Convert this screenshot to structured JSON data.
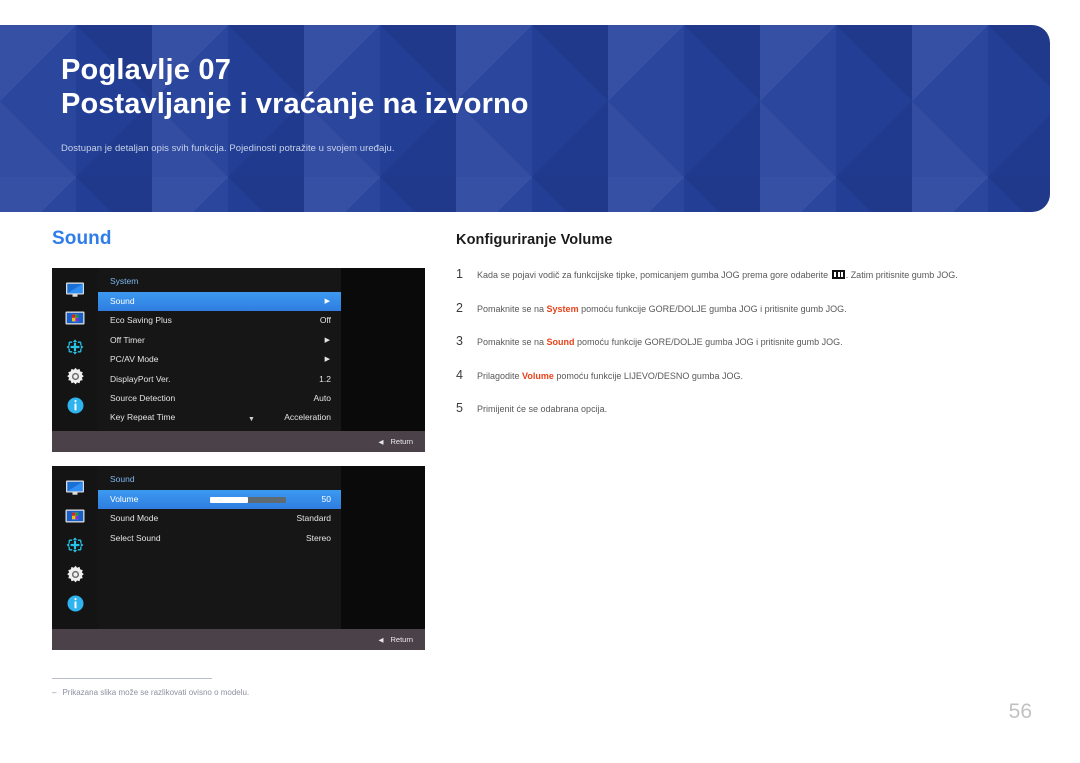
{
  "banner": {
    "chapter_label": "Poglavlje  07",
    "title": "Postavljanje i vraćanje na izvorno",
    "subtitle": "Dostupan je detaljan opis svih funkcija. Pojedinosti potražite u svojem uređaju.",
    "background_color": "#23409a"
  },
  "left": {
    "section_heading": "Sound",
    "accent_color": "#2f7dea"
  },
  "osd1": {
    "title": "System",
    "rail_icons": [
      "monitor-icon",
      "picture-color-icon",
      "directional-pad-icon",
      "gear-icon",
      "info-icon"
    ],
    "rows": [
      {
        "label": "Sound",
        "value": "",
        "arrow": "▶",
        "selected": true
      },
      {
        "label": "Eco Saving Plus",
        "value": "Off",
        "arrow": "",
        "selected": false
      },
      {
        "label": "Off Timer",
        "value": "",
        "arrow": "▶",
        "selected": false
      },
      {
        "label": "PC/AV Mode",
        "value": "",
        "arrow": "▶",
        "selected": false
      },
      {
        "label": "DisplayPort Ver.",
        "value": "1.2",
        "arrow": "",
        "selected": false
      },
      {
        "label": "Source Detection",
        "value": "Auto",
        "arrow": "",
        "selected": false
      },
      {
        "label": "Key Repeat Time",
        "value": "Acceleration",
        "arrow": "",
        "selected": false
      }
    ],
    "scroll_caret": "▼",
    "footer_arrow": "◀",
    "footer_label": "Return"
  },
  "osd2": {
    "title": "Sound",
    "rail_icons": [
      "monitor-icon",
      "picture-color-icon",
      "directional-pad-icon",
      "gear-icon",
      "info-icon"
    ],
    "rows": [
      {
        "label": "Volume",
        "value": "50",
        "slider_percent": 50,
        "selected": true
      },
      {
        "label": "Sound Mode",
        "value": "Standard",
        "selected": false
      },
      {
        "label": "Select Sound",
        "value": "Stereo",
        "selected": false
      }
    ],
    "footer_arrow": "◀",
    "footer_label": "Return"
  },
  "footnote": {
    "dash": "–",
    "text": "Prikazana slika može se razlikovati ovisno o modelu."
  },
  "right": {
    "heading": "Konfiguriranje Volume",
    "steps": [
      {
        "num": "1",
        "pre": "Kada se pojavi vodič za funkcijske tipke, pomicanjem gumba JOG prema gore odaberite ",
        "glyph": "menu-icon",
        "post": ". Zatim pritisnite gumb JOG.",
        "bold": ""
      },
      {
        "num": "2",
        "pre": "Pomaknite se na ",
        "bold": "System",
        "post": " pomoću funkcije GORE/DOLJE gumba JOG i pritisnite gumb JOG."
      },
      {
        "num": "3",
        "pre": "Pomaknite se na ",
        "bold": "Sound",
        "post": " pomoću funkcije GORE/DOLJE gumba JOG i pritisnite gumb JOG."
      },
      {
        "num": "4",
        "pre": "Prilagodite ",
        "bold": "Volume",
        "post": " pomoću funkcije LIJEVO/DESNO gumba JOG."
      },
      {
        "num": "5",
        "pre": "Primijenit će se odabrana opcija.",
        "bold": "",
        "post": ""
      }
    ],
    "highlight_color": "#e8421a"
  },
  "page": {
    "number": "56"
  }
}
